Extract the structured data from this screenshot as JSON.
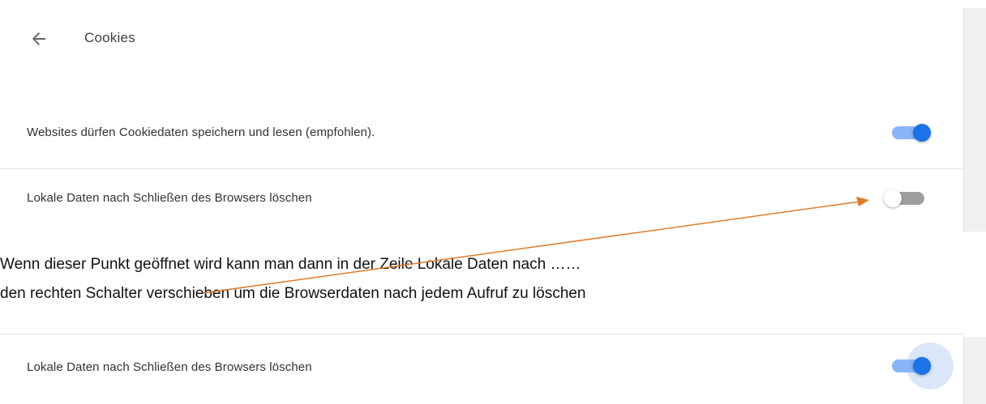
{
  "header": {
    "back_icon": "arrow-left-icon",
    "title": "Cookies"
  },
  "settings": [
    {
      "label": "Websites dürfen Cookiedaten speichern und lesen (empfohlen).",
      "toggle_on": true
    },
    {
      "label": "Lokale Daten nach Schließen des Browsers löschen",
      "toggle_on": false
    }
  ],
  "annotation": {
    "line1": "Wenn dieser Punkt geöffnet wird kann man dann in der Zeile Lokale Daten nach ……",
    "line2": "den rechten Schalter verschieben um die Browserdaten nach jedem Aufruf zu löschen",
    "arrow_color": "#e07b28"
  },
  "after_state": {
    "label": "Lokale Daten nach Schließen des Browsers löschen",
    "toggle_on": true,
    "focused": true
  },
  "colors": {
    "accent": "#1a73e8",
    "accent_track": "#8ab4f8",
    "off_track": "#9e9e9e"
  }
}
